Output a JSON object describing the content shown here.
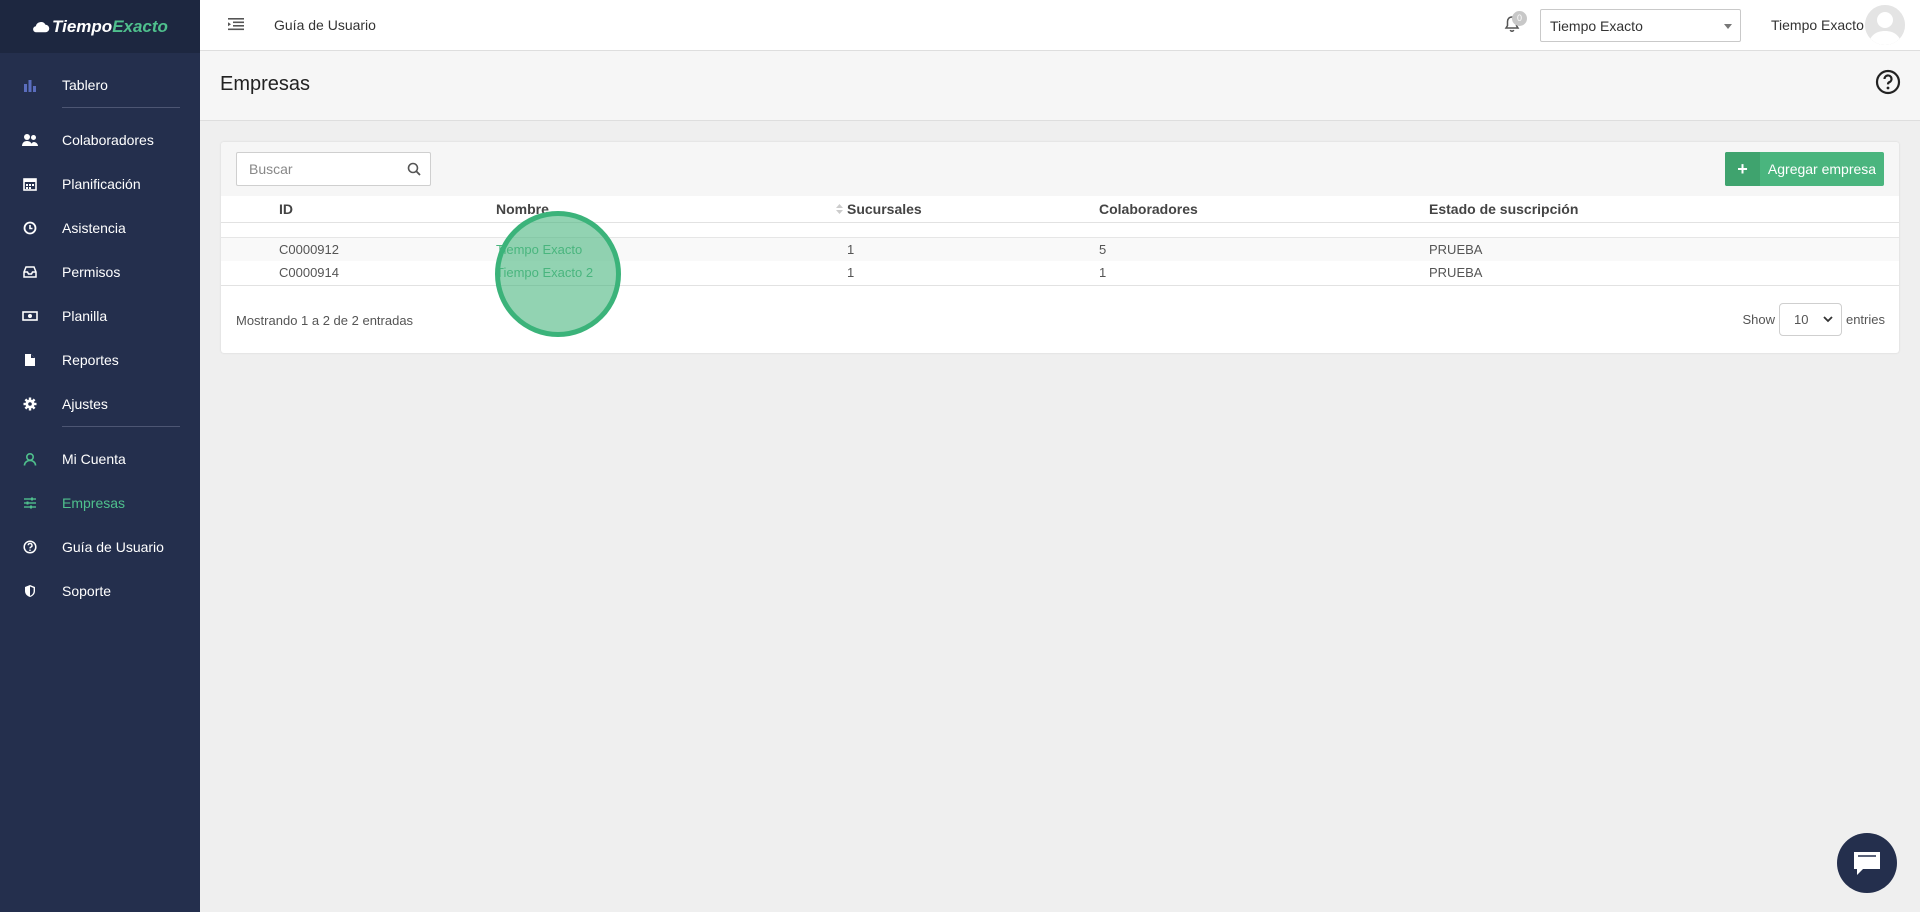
{
  "app": {
    "logo_main": "Tiempo",
    "logo_accent": "Exacto"
  },
  "sidebar": {
    "items": [
      {
        "label": "Tablero",
        "icon": "bar-chart-icon"
      },
      {
        "label": "Colaboradores",
        "icon": "users-icon"
      },
      {
        "label": "Planificación",
        "icon": "calendar-icon"
      },
      {
        "label": "Asistencia",
        "icon": "clock-icon"
      },
      {
        "label": "Permisos",
        "icon": "inbox-icon"
      },
      {
        "label": "Planilla",
        "icon": "money-icon"
      },
      {
        "label": "Reportes",
        "icon": "file-icon"
      },
      {
        "label": "Ajustes",
        "icon": "gear-icon"
      },
      {
        "label": "Mi Cuenta",
        "icon": "user-icon"
      },
      {
        "label": "Empresas",
        "icon": "sliders-icon",
        "active": true
      },
      {
        "label": "Guía de Usuario",
        "icon": "help-icon"
      },
      {
        "label": "Soporte",
        "icon": "shield-icon"
      }
    ]
  },
  "topbar": {
    "guide_link": "Guía de Usuario",
    "notification_count": "0",
    "company_selected": "Tiempo Exacto",
    "user_name": "Tiempo Exacto"
  },
  "page": {
    "title": "Empresas"
  },
  "toolbar": {
    "search_placeholder": "Buscar",
    "add_label": "Agregar empresa",
    "add_icon": "+"
  },
  "table": {
    "headers": [
      "ID",
      "Nombre",
      "Sucursales",
      "Colaboradores",
      "Estado de suscripción"
    ],
    "rows": [
      {
        "id": "C0000912",
        "name": "Tiempo Exacto",
        "branches": "1",
        "staff": "5",
        "status": "PRUEBA"
      },
      {
        "id": "C0000914",
        "name": "Tiempo Exacto 2",
        "branches": "1",
        "staff": "1",
        "status": "PRUEBA"
      }
    ],
    "info": "Mostrando 1 a 2 de 2 entradas",
    "show_label": "Show",
    "page_size": "10",
    "entries_label": "entries"
  },
  "colors": {
    "sidebar_bg": "#242f4d",
    "accent": "#4ab57e",
    "active_nav": "#4fc08d"
  }
}
